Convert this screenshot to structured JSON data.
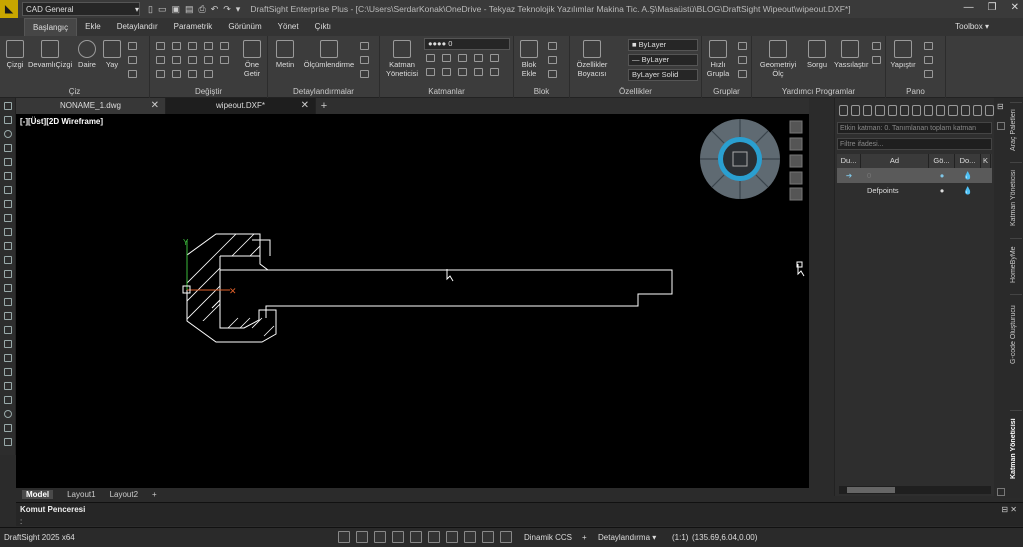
{
  "titlebar": {
    "workspace": "CAD General",
    "title": "DraftSight Enterprise Plus - [C:\\Users\\SerdarKonak\\OneDrive - Tekyaz Teknolojik Yazılımlar Makina Tic. A.Ş\\Masaüstü\\BLOG\\DraftSight Wipeout\\wipeout.DXF*]"
  },
  "menu_tabs": [
    "Başlangıç",
    "Ekle",
    "Detaylandır",
    "Parametrik",
    "Görünüm",
    "Yönet",
    "Çıktı"
  ],
  "toolbox_label": "Toolbox",
  "ribbon": {
    "groups": [
      "Çiz",
      "Değiştir",
      "Detaylandırmalar",
      "Katmanlar",
      "Blok",
      "Özellikler",
      "Gruplar",
      "Yardımcı Programlar",
      "Pano"
    ],
    "buttons": {
      "cizgi": "Çizgi",
      "devamli": "DevamlıÇizgi",
      "daire": "Daire",
      "yay": "Yay",
      "one_getir": "Öne Getir",
      "metin": "Metin",
      "olcumlendirme": "Ölçümlendirme",
      "katman_yoneticisi": "Katman Yöneticisi",
      "blok_ekle": "Blok Ekle",
      "ozellikler_boyacisi": "Özellikler Boyacısı",
      "hizli_grupla": "Hızlı Grupla",
      "geometriyi_olc": "Geometriyi Ölç",
      "sorgu": "Sorgu",
      "yasilastir": "Yassılaştır",
      "yapistir": "Yapıştır"
    },
    "layer_combo": "0",
    "prop_combos": [
      "ByLayer",
      "ByLayer",
      "ByLayer"
    ],
    "linestyle": "Solid"
  },
  "doc_tabs": [
    {
      "name": "NONAME_1.dwg"
    },
    {
      "name": "wipeout.DXF*"
    }
  ],
  "canvas": {
    "view_label": "[-][Üst][2D Wireframe]",
    "axis_y": "Y"
  },
  "model_tabs": [
    "Model",
    "Layout1",
    "Layout2"
  ],
  "command": {
    "title": "Komut Penceresi",
    "prompt": ":"
  },
  "status": {
    "app": "DraftSight 2025 x64",
    "ccs": "Dinamik CCS",
    "detail": "Detaylandırma",
    "scale": "(1:1)",
    "coords": "(135.69,6.04,0.00)"
  },
  "layer_panel": {
    "info": "Etkin katman: 0. Tanımlanan toplam katman",
    "filter": "Filtre ifadesi...",
    "headers": [
      "Du...",
      "Ad",
      "Gö...",
      "Do...",
      "K"
    ],
    "rows": [
      {
        "name": "0",
        "current": true
      },
      {
        "name": "Defpoints",
        "current": false
      }
    ]
  },
  "side_tabs": [
    "Araç Paletleri",
    "Katman Yöneticisi",
    "HomeByMe",
    "G-code Oluşturucu",
    "Katman Yöneticisi"
  ]
}
